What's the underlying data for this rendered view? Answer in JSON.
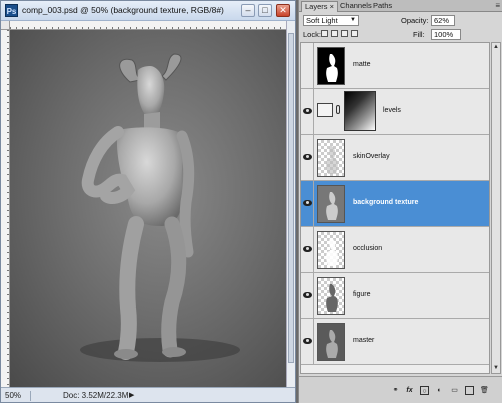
{
  "document": {
    "title": "comp_003.psd @ 50% (background texture, RGB/8#)",
    "app_icon": "Ps",
    "zoom": "50%",
    "doc_info": "Doc: 3.52M/22.3M",
    "status_arrow": "▶",
    "window_buttons": {
      "minimize": "–",
      "maximize": "□",
      "close": "✕"
    }
  },
  "panel": {
    "tabs": [
      "Layers ×",
      "Channels",
      "Paths"
    ],
    "menu_icon": "menu-icon",
    "blend_mode": "Soft Light",
    "opacity_label": "Opacity:",
    "opacity_value": "62%",
    "lock_label": "Lock:",
    "fill_label": "Fill:",
    "fill_value": "100%"
  },
  "layers": [
    {
      "name": "matte",
      "visible": false,
      "selected": false,
      "thumb": "matte"
    },
    {
      "name": "levels",
      "visible": true,
      "selected": false,
      "thumb": "adjustment-mask"
    },
    {
      "name": "skinOverlay",
      "visible": true,
      "selected": false,
      "thumb": "figure-transparent"
    },
    {
      "name": "background texture",
      "visible": true,
      "selected": true,
      "thumb": "figure-gray"
    },
    {
      "name": "occlusion",
      "visible": true,
      "selected": false,
      "thumb": "figure-transparent-white"
    },
    {
      "name": "figure",
      "visible": true,
      "selected": false,
      "thumb": "figure-transparent-dark"
    },
    {
      "name": "master",
      "visible": true,
      "selected": false,
      "thumb": "figure-gray"
    }
  ],
  "footer_icons": [
    "link-icon",
    "fx-icon",
    "mask-icon",
    "adjustment-icon",
    "folder-icon",
    "new-layer-icon",
    "trash-icon"
  ],
  "colors": {
    "selection": "#4a8ed4",
    "panel": "#d6d6d6",
    "canvas": "#6e6e6e"
  }
}
